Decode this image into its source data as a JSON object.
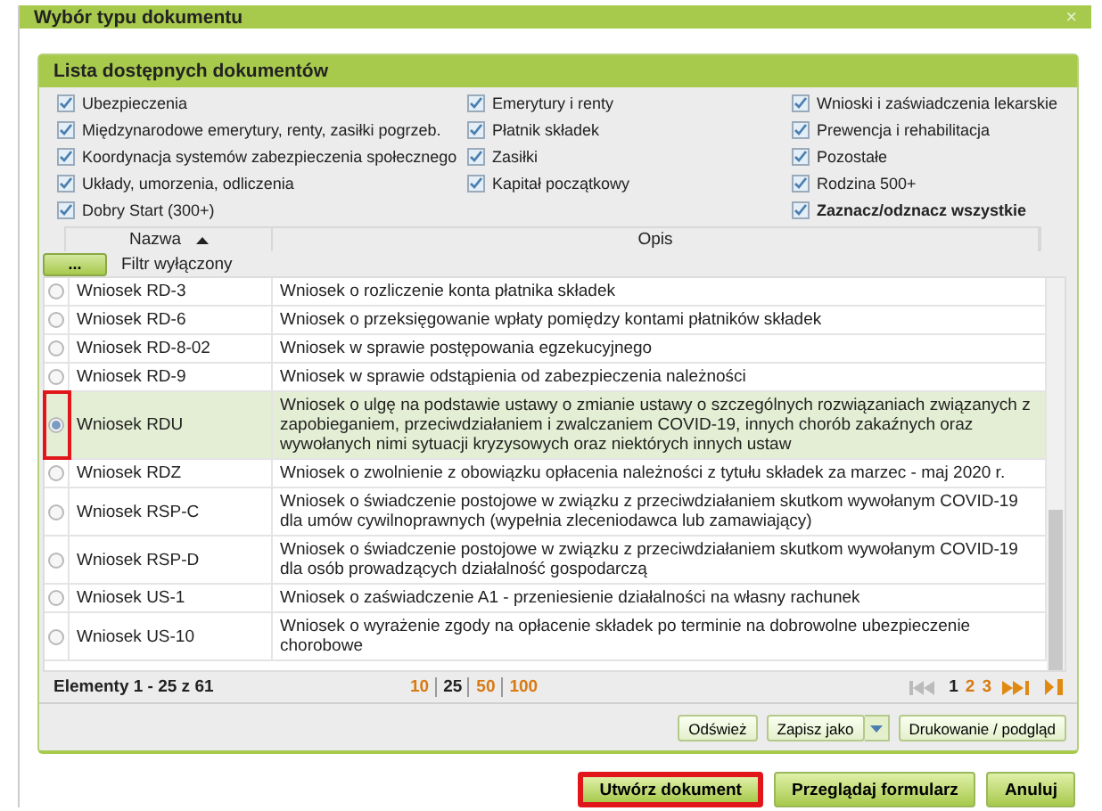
{
  "window": {
    "title": "Wybór typu dokumentu",
    "close": "×"
  },
  "panel": {
    "title": "Lista dostępnych dokumentów",
    "filters": [
      {
        "label": "Ubezpieczenia",
        "checked": true
      },
      {
        "label": "Emerytury i renty",
        "checked": true
      },
      {
        "label": "Wnioski i zaświadczenia lekarskie",
        "checked": true
      },
      {
        "label": "Międzynarodowe emerytury, renty, zasiłki pogrzeb.",
        "checked": true
      },
      {
        "label": "Płatnik składek",
        "checked": true
      },
      {
        "label": "Prewencja i rehabilitacja",
        "checked": true
      },
      {
        "label": "Koordynacja systemów zabezpieczenia społecznego",
        "checked": true
      },
      {
        "label": "Zasiłki",
        "checked": true
      },
      {
        "label": "Pozostałe",
        "checked": true
      },
      {
        "label": "Układy, umorzenia, odliczenia",
        "checked": true
      },
      {
        "label": "Kapitał początkowy",
        "checked": true
      },
      {
        "label": "Rodzina 500+",
        "checked": true
      },
      {
        "label": "Dobry Start (300+)",
        "checked": true
      },
      {
        "kind": "empty"
      },
      {
        "label": "Zaznacz/odznacz wszystkie",
        "checked": true,
        "kind": "all"
      }
    ],
    "table": {
      "columns": [
        "Nazwa",
        "Opis"
      ],
      "filter_button": "...",
      "filter_status": "Filtr wyłączony",
      "rows": [
        {
          "name": "Wniosek RD-3",
          "description": "Wniosek o rozliczenie konta płatnika składek",
          "selected": false
        },
        {
          "name": "Wniosek RD-6",
          "description": "Wniosek o przeksięgowanie wpłaty pomiędzy kontami płatników składek",
          "selected": false
        },
        {
          "name": "Wniosek RD-8-02",
          "description": "Wniosek w sprawie postępowania egzekucyjnego",
          "selected": false
        },
        {
          "name": "Wniosek RD-9",
          "description": "Wniosek w sprawie odstąpienia od zabezpieczenia należności",
          "selected": false
        },
        {
          "name": "Wniosek RDU",
          "description": "Wniosek o ulgę na podstawie ustawy o zmianie ustawy o szczególnych rozwiązaniach związanych z zapobieganiem, przeciwdziałaniem i zwalczaniem COVID-19, innych chorób zakaźnych oraz wywołanych nimi sytuacji kryzysowych oraz niektórych innych ustaw",
          "selected": true
        },
        {
          "name": "Wniosek RDZ",
          "description": "Wniosek o zwolnienie z obowiązku opłacenia należności z tytułu składek za marzec - maj 2020 r.",
          "selected": false
        },
        {
          "name": "Wniosek RSP-C",
          "description": "Wniosek o świadczenie postojowe w związku z przeciwdziałaniem skutkom wywołanym COVID-19 dla umów cywilnoprawnych (wypełnia zleceniodawca lub zamawiający)",
          "selected": false
        },
        {
          "name": "Wniosek RSP-D",
          "description": "Wniosek o świadczenie postojowe w związku z przeciwdziałaniem skutkom wywołanym COVID-19 dla osób prowadzących działalność gospodarczą",
          "selected": false
        },
        {
          "name": "Wniosek US-1",
          "description": "Wniosek o zaświadczenie A1 - przeniesienie działalności na własny rachunek",
          "selected": false
        },
        {
          "name": "Wniosek US-10",
          "description": "Wniosek o wyrażenie zgody na opłacenie składek po terminie na dobrowolne ubezpieczenie chorobowe",
          "selected": false
        }
      ]
    },
    "pager": {
      "summary": "Elementy 1 - 25 z 61",
      "page_sizes": [
        {
          "label": "10",
          "selected": false
        },
        {
          "label": "25",
          "selected": true
        },
        {
          "label": "50",
          "selected": false
        },
        {
          "label": "100",
          "selected": false
        }
      ],
      "pages": [
        {
          "label": "1",
          "selected": true
        },
        {
          "label": "2",
          "selected": false
        },
        {
          "label": "3",
          "selected": false
        }
      ]
    },
    "tools": [
      "Odśwież",
      "Zapisz jako",
      "Drukowanie / podgląd"
    ]
  },
  "buttons": [
    {
      "label": "Utwórz dokument",
      "highlighted": true
    },
    {
      "label": "Przeglądaj formularz",
      "highlighted": false
    },
    {
      "label": "Anuluj",
      "highlighted": false
    }
  ]
}
